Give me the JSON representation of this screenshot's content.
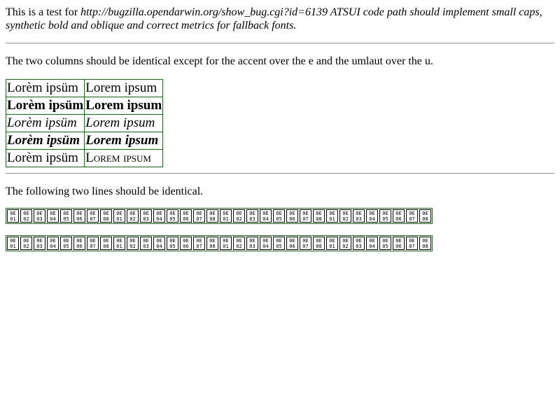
{
  "intro": {
    "prefix": "This is a test for ",
    "link_and_title": "http://bugzilla.opendarwin.org/show_bug.cgi?id=6139 ATSUI code path should implement small caps, synthetic bold and oblique and correct metrics for fallback fonts."
  },
  "section1": {
    "instruction": "The two columns should be identical except for the accent over the e and the umlaut over the u."
  },
  "table": {
    "rows": [
      {
        "style": "normal",
        "left": "Lorèm ipsüm",
        "right": "Lorem ipsum"
      },
      {
        "style": "bold",
        "left": "Lorèm ipsüm",
        "right": "Lorem ipsum"
      },
      {
        "style": "italic",
        "left": "Lorèm ipsüm",
        "right": "Lorem ipsum"
      },
      {
        "style": "bold-italic",
        "left": "Lorèm ipsüm",
        "right": "Lorem ipsum"
      },
      {
        "style": "small-caps",
        "left": "Lorèm ipsüm",
        "right": "Lorem ipsum"
      }
    ]
  },
  "section2": {
    "instruction": "The following two lines should be identical."
  },
  "glyph_lines": {
    "line1": {
      "glyphs": [
        {
          "top": "0E",
          "bottom": "01"
        },
        {
          "top": "0E",
          "bottom": "02"
        },
        {
          "top": "0E",
          "bottom": "03"
        },
        {
          "top": "0E",
          "bottom": "04"
        },
        {
          "top": "0E",
          "bottom": "05"
        },
        {
          "top": "0E",
          "bottom": "06"
        },
        {
          "top": "0E",
          "bottom": "07"
        },
        {
          "top": "0E",
          "bottom": "08"
        },
        {
          "top": "0E",
          "bottom": "01"
        },
        {
          "top": "0E",
          "bottom": "02"
        },
        {
          "top": "0E",
          "bottom": "03"
        },
        {
          "top": "0E",
          "bottom": "04"
        },
        {
          "top": "0E",
          "bottom": "05"
        },
        {
          "top": "0E",
          "bottom": "06"
        },
        {
          "top": "0E",
          "bottom": "07"
        },
        {
          "top": "0E",
          "bottom": "08"
        },
        {
          "top": "0E",
          "bottom": "01"
        },
        {
          "top": "0E",
          "bottom": "02"
        },
        {
          "top": "0E",
          "bottom": "03"
        },
        {
          "top": "0E",
          "bottom": "04"
        },
        {
          "top": "0E",
          "bottom": "05"
        },
        {
          "top": "0E",
          "bottom": "06"
        },
        {
          "top": "0E",
          "bottom": "07"
        },
        {
          "top": "0E",
          "bottom": "08"
        },
        {
          "top": "0E",
          "bottom": "01"
        },
        {
          "top": "0E",
          "bottom": "02"
        },
        {
          "top": "0E",
          "bottom": "03"
        },
        {
          "top": "0E",
          "bottom": "04"
        },
        {
          "top": "0E",
          "bottom": "05"
        },
        {
          "top": "0E",
          "bottom": "06"
        },
        {
          "top": "0E",
          "bottom": "07"
        },
        {
          "top": "0E",
          "bottom": "08"
        }
      ]
    },
    "line2": {
      "glyphs": [
        {
          "top": "0E",
          "bottom": "01"
        },
        {
          "top": "0E",
          "bottom": "02"
        },
        {
          "top": "0E",
          "bottom": "03"
        },
        {
          "top": "0E",
          "bottom": "04"
        },
        {
          "top": "0E",
          "bottom": "05"
        },
        {
          "top": "0E",
          "bottom": "06"
        },
        {
          "top": "0E",
          "bottom": "07"
        },
        {
          "top": "0E",
          "bottom": "08"
        },
        {
          "top": "0E",
          "bottom": "01"
        },
        {
          "top": "0E",
          "bottom": "02"
        },
        {
          "top": "0E",
          "bottom": "03"
        },
        {
          "top": "0E",
          "bottom": "04"
        },
        {
          "top": "0E",
          "bottom": "05"
        },
        {
          "top": "0E",
          "bottom": "06"
        },
        {
          "top": "0E",
          "bottom": "07"
        },
        {
          "top": "0E",
          "bottom": "08"
        },
        {
          "top": "0E",
          "bottom": "01"
        },
        {
          "top": "0E",
          "bottom": "02"
        },
        {
          "top": "0E",
          "bottom": "03"
        },
        {
          "top": "0E",
          "bottom": "04"
        },
        {
          "top": "0E",
          "bottom": "05"
        },
        {
          "top": "0E",
          "bottom": "06"
        },
        {
          "top": "0E",
          "bottom": "07"
        },
        {
          "top": "0E",
          "bottom": "08"
        },
        {
          "top": "0E",
          "bottom": "01"
        },
        {
          "top": "0E",
          "bottom": "02"
        },
        {
          "top": "0E",
          "bottom": "03"
        },
        {
          "top": "0E",
          "bottom": "04"
        },
        {
          "top": "0E",
          "bottom": "05"
        },
        {
          "top": "0E",
          "bottom": "06"
        },
        {
          "top": "0E",
          "bottom": "07"
        },
        {
          "top": "0E",
          "bottom": "08"
        }
      ]
    }
  },
  "colors": {
    "border_green": "#008000",
    "rule_gray": "#9a9a9a"
  }
}
